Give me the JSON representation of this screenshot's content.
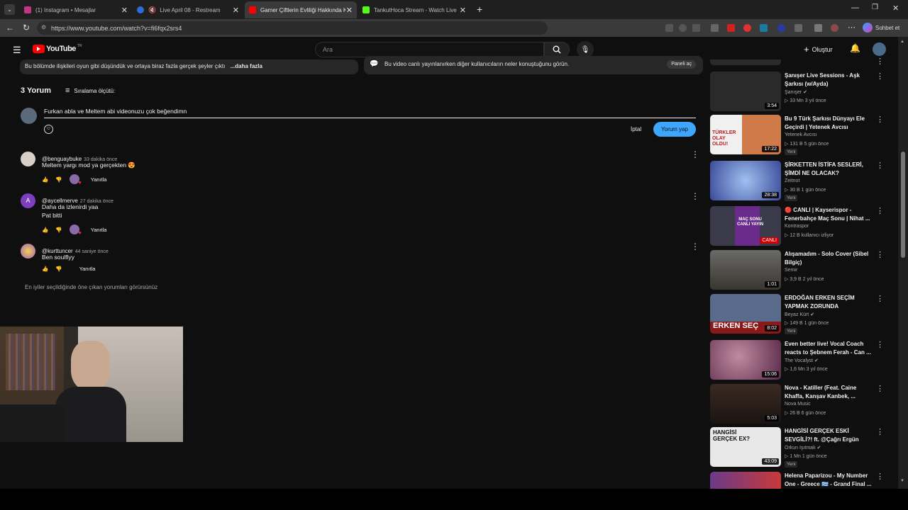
{
  "browser": {
    "tabs": [
      {
        "label": "(1) Instagram • Mesajlar",
        "active": false
      },
      {
        "label": "Live April 08 - Restream",
        "active": false
      },
      {
        "label": "Gamer Çiftlerin Evliliği Hakkında Ki",
        "active": true
      },
      {
        "label": "TankutHoca Stream - Watch Live",
        "active": false
      }
    ],
    "url": "https://www.youtube.com/watch?v=fi6fqx2srs4",
    "chat_label": "Sohbet et"
  },
  "youtube": {
    "logo_text": "YouTube",
    "region": "TR",
    "search_placeholder": "Ara",
    "create_label": "Oluştur"
  },
  "description": {
    "snippet": "Bu bölümde ilişkileri oyun gibi düşündük ve ortaya biraz fazla gerçek şeyler çıktı",
    "more_label": "...daha fazla"
  },
  "live_chat": {
    "text": "Bu video canlı yayınlanırken diğer kullanıcıların neler konuştuğunu görün.",
    "button": "Paneli aç"
  },
  "comments": {
    "count_label": "3 Yorum",
    "sort_label": "Sıralama ölçütü:",
    "draft": "Furkan abla ve Meltem abi videonuzu çok beğendimn",
    "cancel_label": "İptal",
    "submit_label": "Yorum yap",
    "items": [
      {
        "handle": "@benguaybuke",
        "time": "33 dakika önce",
        "text": "Meltem yargı mod ya gerçekten 😍",
        "reply": "Yanıtla",
        "avatar_color": "#d8d0c8"
      },
      {
        "handle": "@aycellmerve",
        "time": "27 dakika önce",
        "text": "Daha da izlenirdi yaa",
        "text2": "Pat bitti",
        "reply": "Yanıtla",
        "avatar_letter": "A",
        "avatar_color": "#7b3fbf"
      },
      {
        "handle": "@kurttuncer",
        "time": "44 saniye önce",
        "text": "Ben soulflyy",
        "reply": "Yanıtla",
        "avatar_color": "#c8a030"
      }
    ],
    "footer": "En iyiler seçildiğinde öne çıkan yorumları görürsünüz"
  },
  "sidebar": [
    {
      "title": "Şanışer Live Sessions - Aşk Şarkısı (w/Ayda)",
      "channel": "Şanışer",
      "meta": "33 Mn  3 yıl önce",
      "duration": "3:54",
      "thumb_color": "#2a2a2a",
      "verified": true,
      "new": ""
    },
    {
      "title": "Bu 9 Türk Şarkısı Dünyayı Ele Geçirdi | Yetenek Avcısı",
      "channel": "Yetenek Avcısı",
      "meta": "131 B  5 gün önce",
      "duration": "17:22",
      "thumb_color": "#d07a4a",
      "verified": false,
      "new": "Yeni"
    },
    {
      "title": "ŞİRKETTEN İSTİFA SESLERİ, ŞİMDİ NE OLACAK?",
      "channel": "Zeitnot",
      "meta": "30 B  1 gün önce",
      "duration": "28:38",
      "thumb_color": "#4a6ab8",
      "verified": false,
      "new": "Yeni"
    },
    {
      "title": "🔴 CANLI | Kayserispor - Fenerbahçe Maç Sonu | Nihat ...",
      "channel": "Kontraspor",
      "meta": "12 B kullanıcı izliyor",
      "duration": "CANLI",
      "thumb_color": "#6a2a8a",
      "verified": false,
      "new": "",
      "live": true
    },
    {
      "title": "Alışamadım - Solo Cover (Sibel Bilgiç)",
      "channel": "Semir",
      "meta": "3,9 B  2 yıl önce",
      "duration": "1:01",
      "thumb_color": "#5a5a5a",
      "verified": false,
      "new": ""
    },
    {
      "title": "ERDOĞAN ERKEN SEÇİM YAPMAK ZORUNDA",
      "channel": "Beyaz Kürt",
      "meta": "149 B  1 gün önce",
      "duration": "8:02",
      "thumb_color": "#8a1a1a",
      "verified": true,
      "new": "Yeni"
    },
    {
      "title": "Even better live! Vocal Coach reacts to Şebnem Ferah - Can ...",
      "channel": "The Vocalyst",
      "meta": "1,6 Mn  3 yıl önce",
      "duration": "15:06",
      "thumb_color": "#7a3a6a",
      "verified": true,
      "new": ""
    },
    {
      "title": "Nova - Katiller (Feat. Caine Khaffa, Kanşav Kanbek, ...",
      "channel": "Nova Music",
      "meta": "26 B  6 gün önce",
      "duration": "5:03",
      "thumb_color": "#3a2a22",
      "verified": false,
      "new": "Yeni"
    },
    {
      "title": "HANGİSİ GERÇEK ESKİ SEVGİLİ?! ft. @Çağrı Ergün",
      "channel": "Orkun Işıtmak",
      "meta": "1 Mn  1 gün önce",
      "duration": "43:09",
      "thumb_color": "#d8d8d8",
      "verified": true,
      "new": "Yeni"
    },
    {
      "title": "Helena Paparizou - My Number One - Greece 🇬🇷 - Grand Final ...",
      "channel": "",
      "meta": "",
      "duration": "",
      "thumb_color": "#c83a3a",
      "verified": false,
      "new": ""
    }
  ]
}
